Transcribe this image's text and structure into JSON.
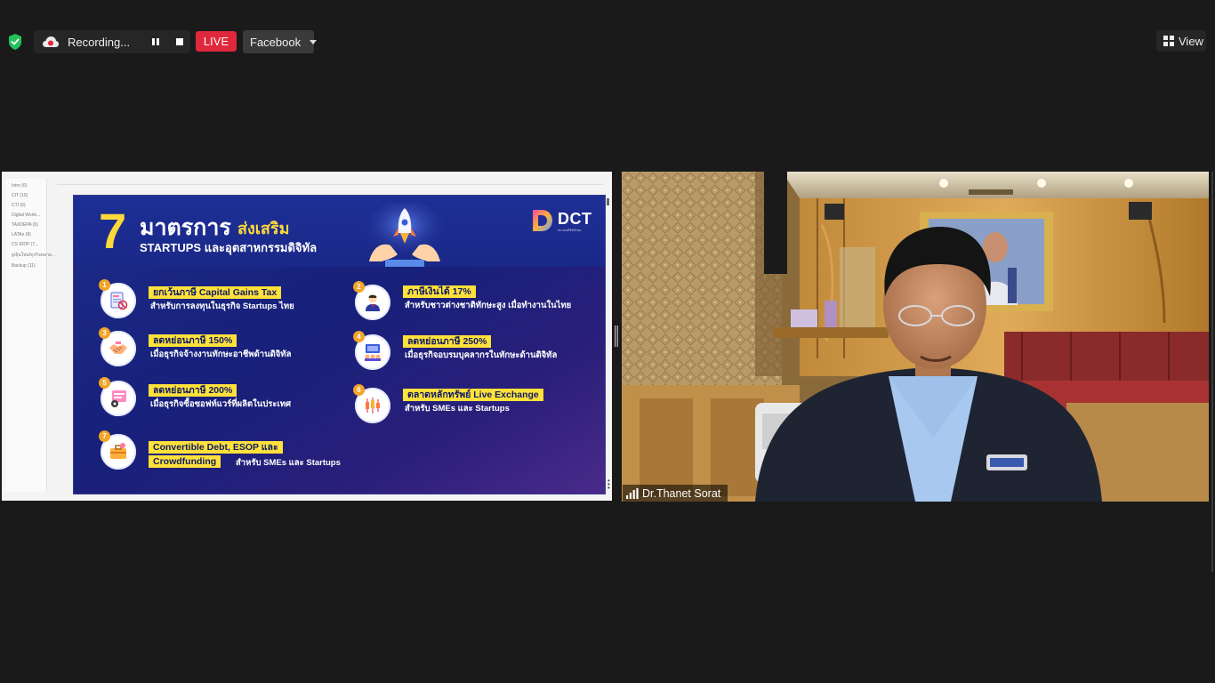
{
  "toolbar": {
    "recording_label": "Recording...",
    "live_label": "LIVE",
    "platform_label": "Facebook",
    "view_label": "View"
  },
  "share_sidebar": {
    "items": [
      "Intro (6)",
      "CIT (10)",
      "CTI (6)",
      "Digital Worki...",
      "TAXDEPA (6)",
      "LATAx (8)",
      "CS IDDP (7...",
      "ฐ/ลุ้นใหม่/ธุรกิจหลาย...",
      "Backup (11)"
    ]
  },
  "slide": {
    "number_big": "7",
    "title_main": "มาตรการ",
    "title_accent": "ส่งเสริม",
    "subtitle": "STARTUPS และอุตสาหกรรมดิจิทัล",
    "logo_text": "DCT",
    "logo_subtext": "สมาคมดิจิทัลไทย",
    "items": [
      {
        "num": "1",
        "headline": "ยกเว้นภาษี Capital Gains Tax",
        "desc": "สำหรับการลงทุนในธุรกิจ Startups ไทย",
        "icon": "document-icon"
      },
      {
        "num": "2",
        "headline": "ภาษีเงินได้ 17%",
        "desc": "สำหรับชาวต่างชาติทักษะสูง เมื่อทำงานในไทย",
        "icon": "person-icon"
      },
      {
        "num": "3",
        "headline": "ลดหย่อนภาษี 150%",
        "desc": "เมื่อธุรกิจจ้างงานทักษะอาชีพด้านดิจิทัล",
        "icon": "handshake-icon"
      },
      {
        "num": "4",
        "headline": "ลดหย่อนภาษี 250%",
        "desc": "เมื่อธุรกิจอบรมบุคลากรในทักษะด้านดิจิทัล",
        "icon": "training-icon"
      },
      {
        "num": "5",
        "headline": "ลดหย่อนภาษี 200%",
        "desc": "เมื่อธุรกิจซื้อซอฟท์แวร์ที่ผลิตในประเทศ",
        "icon": "software-icon"
      },
      {
        "num": "6",
        "headline": "ตลาดหลักทรัพย์ Live Exchange",
        "desc": "สำหรับ SMEs และ Startups",
        "icon": "chart-icon"
      },
      {
        "num": "7",
        "headline_line1": "Convertible Debt, ESOP และ",
        "headline_line2": "Crowdfunding",
        "desc": "สำหรับ SMEs และ Startups",
        "icon": "briefcase-icon"
      }
    ]
  },
  "participant": {
    "name": "Dr.Thanet Sorat"
  },
  "colors": {
    "background": "#1a1a1a",
    "live": "#e0283c",
    "slide_bg": "#17207a",
    "highlight": "#ffe13a",
    "accent_yellow": "#ffd93a"
  }
}
